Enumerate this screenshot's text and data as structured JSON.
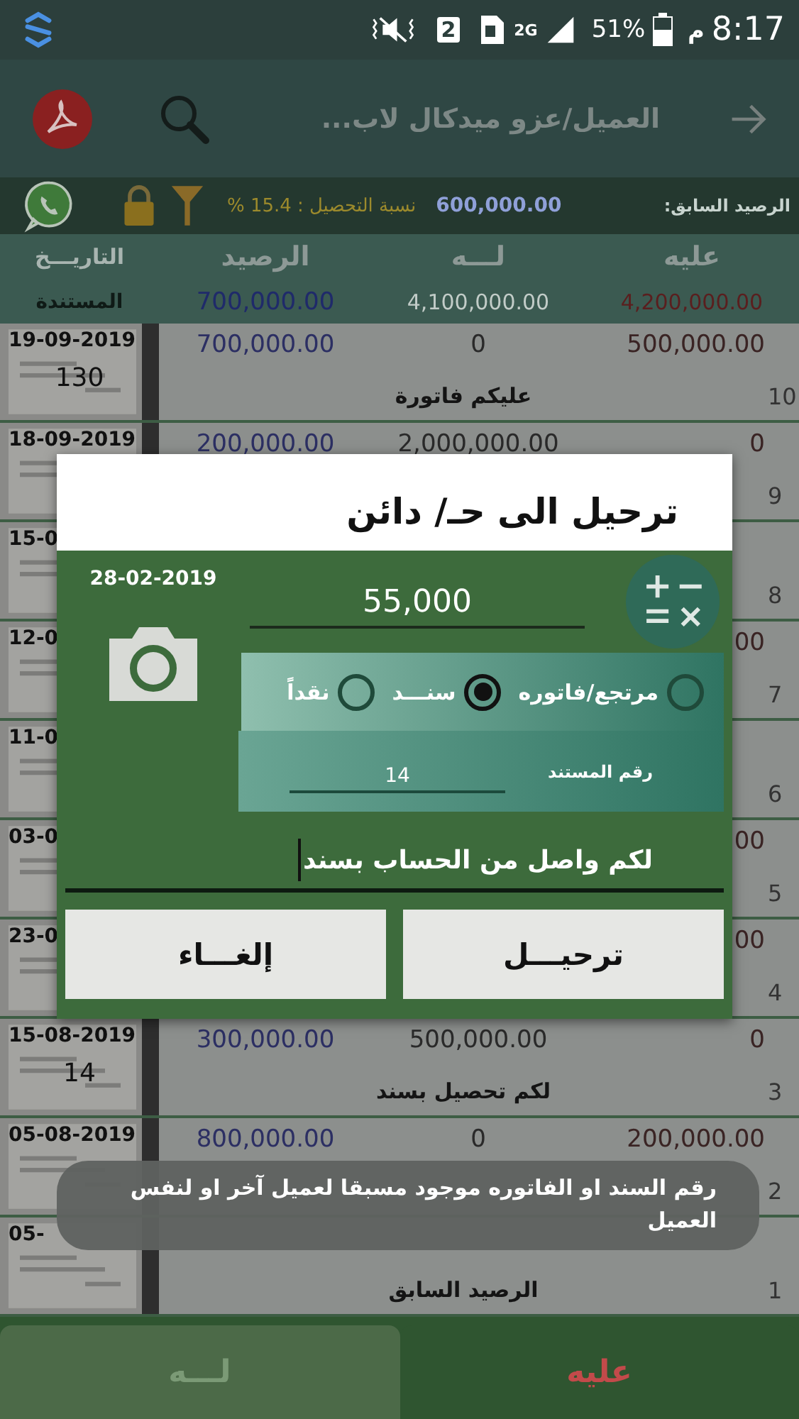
{
  "status_bar": {
    "sim_slot": "2",
    "network": "2G",
    "battery": "51%",
    "period": "م",
    "time": "8:17"
  },
  "app_bar": {
    "title": "العميل/عزو ميدكال لاب..."
  },
  "summary": {
    "previous_balance_label": "الرصيد السابق:",
    "previous_balance": "600,000.00",
    "collection_label": "نسبة التحصيل :",
    "collection_rate": "15.4 %"
  },
  "table": {
    "columns": [
      "عليه",
      "لـــه",
      "الرصيد",
      "التاريـــخ"
    ],
    "totals": {
      "label": "المستندة",
      "balance": "700,000.00",
      "credit": "4,100,000.00",
      "debit": "4,200,000.00"
    },
    "rows": [
      {
        "date": "19-09-2019",
        "doc": "130",
        "balance": "700,000.00",
        "credit": "0",
        "debit": "500,000.00",
        "description": "عليكم فاتورة",
        "number": "10"
      },
      {
        "date": "18-09-2019",
        "balance": "200,000.00",
        "credit": "2,000,000.00",
        "debit": "0",
        "number": "9"
      },
      {
        "date": "15-0",
        "number": "8"
      },
      {
        "date": "12-0",
        "debit": "00",
        "number": "7"
      },
      {
        "date": "11-0",
        "number": "6"
      },
      {
        "date": "03-0",
        "debit": "00",
        "number": "5"
      },
      {
        "date": "23-0",
        "debit": "00",
        "number": "4"
      },
      {
        "date": "15-08-2019",
        "doc": "14",
        "balance": "300,000.00",
        "credit": "500,000.00",
        "debit": "0",
        "description": "لكم تحصيل بسند",
        "number": "3"
      },
      {
        "date": "05-08-2019",
        "balance": "800,000.00",
        "credit": "0",
        "debit": "200,000.00",
        "number": "2"
      },
      {
        "date": "05-",
        "description": "الرصيد السابق",
        "number": "1"
      }
    ]
  },
  "bottom_bar": {
    "buttons": [
      {
        "label": "عليه",
        "kind": "debit"
      },
      {
        "label": "لـــه",
        "kind": "credit"
      }
    ]
  },
  "dialog": {
    "title": "ترحيل الى حـ/ دائن",
    "date": "28-02-2019",
    "amount": "55,000",
    "doc_types": [
      {
        "label": "مرتجع/فاتوره",
        "selected": false
      },
      {
        "label": "سنـــد",
        "selected": true
      },
      {
        "label": "نقداً",
        "selected": false
      }
    ],
    "doc_number_label": "رقم المستند",
    "doc_number": "14",
    "description": "لكم واصل من الحساب بسند",
    "buttons": [
      "ترحيـــل",
      "إلغـــاء"
    ]
  },
  "toast": {
    "message": "رقم السند او الفاتوره موجود مسبقا لعميل آخر او لنفس العميل"
  }
}
